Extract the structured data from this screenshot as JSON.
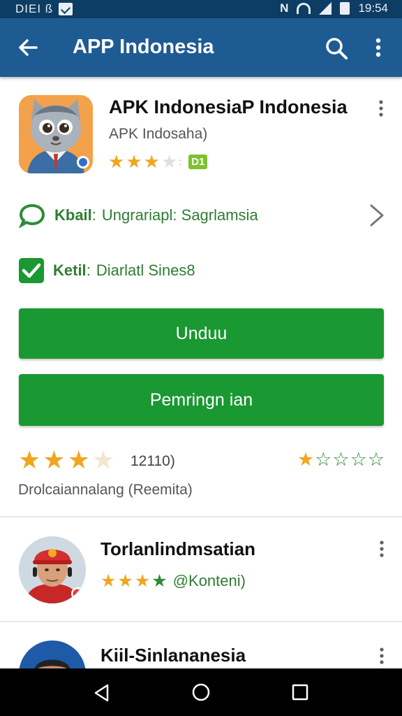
{
  "status_bar": {
    "left_text": "DIEI ß",
    "right_time": "19:54",
    "icons": [
      "nfc-icon",
      "wifi-icon",
      "signal-icon",
      "battery-icon"
    ]
  },
  "app_bar": {
    "title": "APP Indonesia",
    "color": "#1f5b93",
    "icons": [
      "back-arrow-icon",
      "search-icon",
      "more-vert-icon"
    ]
  },
  "app": {
    "name": "APK IndonesiaP Indonesia",
    "subtitle": "APK Indosaha)",
    "rating_stars": 3,
    "badge": "D1",
    "icon": "cat-mascot-icon"
  },
  "info": {
    "row1_label": "Kbail",
    "row1_sep": ":",
    "row1_value": "Ungrariapl: Sagrlamsia",
    "row2_label": "Ketil",
    "row2_sep": ":",
    "row2_value": "Diarlatl Sines8"
  },
  "buttons": {
    "download": "Unduu",
    "update": "Pemringn ian",
    "color": "#1a9831"
  },
  "rating": {
    "stars": 3,
    "count": "12110)",
    "small_stars": 5,
    "note": "Drolcaiannalang (Reemita)"
  },
  "list": [
    {
      "title": "Torlanlindmsatian",
      "stars": 4,
      "rating_text": "@Konteni)",
      "avatar": "man-with-red-cap-avatar"
    },
    {
      "title": "Kiil-Sinlananesia",
      "avatar": "man-avatar"
    }
  ],
  "nav": {
    "icons": [
      "nav-back-icon",
      "nav-home-icon",
      "nav-recent-icon"
    ]
  }
}
